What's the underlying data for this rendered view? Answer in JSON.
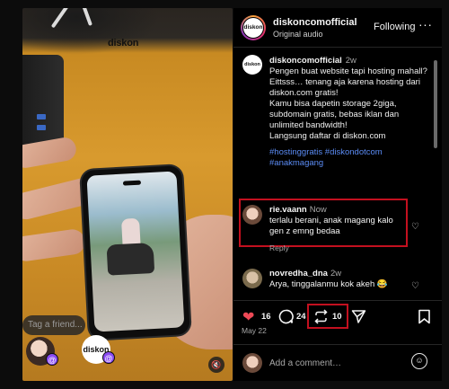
{
  "media": {
    "sticker_text": "diskon",
    "tag_placeholder": "Tag a friend...",
    "tag_brand": "diskon",
    "tag_badge": "@",
    "mute_icon": "🔇"
  },
  "header": {
    "username": "diskoncomofficial",
    "subtitle": "Original audio",
    "follow_label": "Following",
    "more_label": "···",
    "avatar_text": "diskon"
  },
  "caption": {
    "username": "diskoncomofficial",
    "time": "2w",
    "lines": [
      "Pengen buat website tapi hosting mahall?",
      "Eittsss… tenang aja karena hosting dari diskon.com gratis!",
      "Kamu bisa dapetin storage 2giga, subdomain gratis, bebas iklan dan unlimited bandwidth!",
      "Langsung daftar di diskon.com"
    ],
    "hashtags": "#hostinggratis #diskondotcom #anakmagang"
  },
  "comments": [
    {
      "username": "rie.vaann",
      "time": "Now",
      "text": "terlalu berani, anak magang kalo gen z emng bedaa",
      "reply_label": "Reply"
    },
    {
      "username": "novredha_dna",
      "time": "2w",
      "text": "Arya, tinggalanmu kok akeh 😂"
    }
  ],
  "actions": {
    "likes": "16",
    "comments": "24",
    "reposts": "10",
    "date": "May 22"
  },
  "add_comment": {
    "placeholder": "Add a comment…"
  },
  "colors": {
    "accent_red": "#c3101f",
    "heart": "#ed4956",
    "hashtag": "#5b8cf5"
  }
}
